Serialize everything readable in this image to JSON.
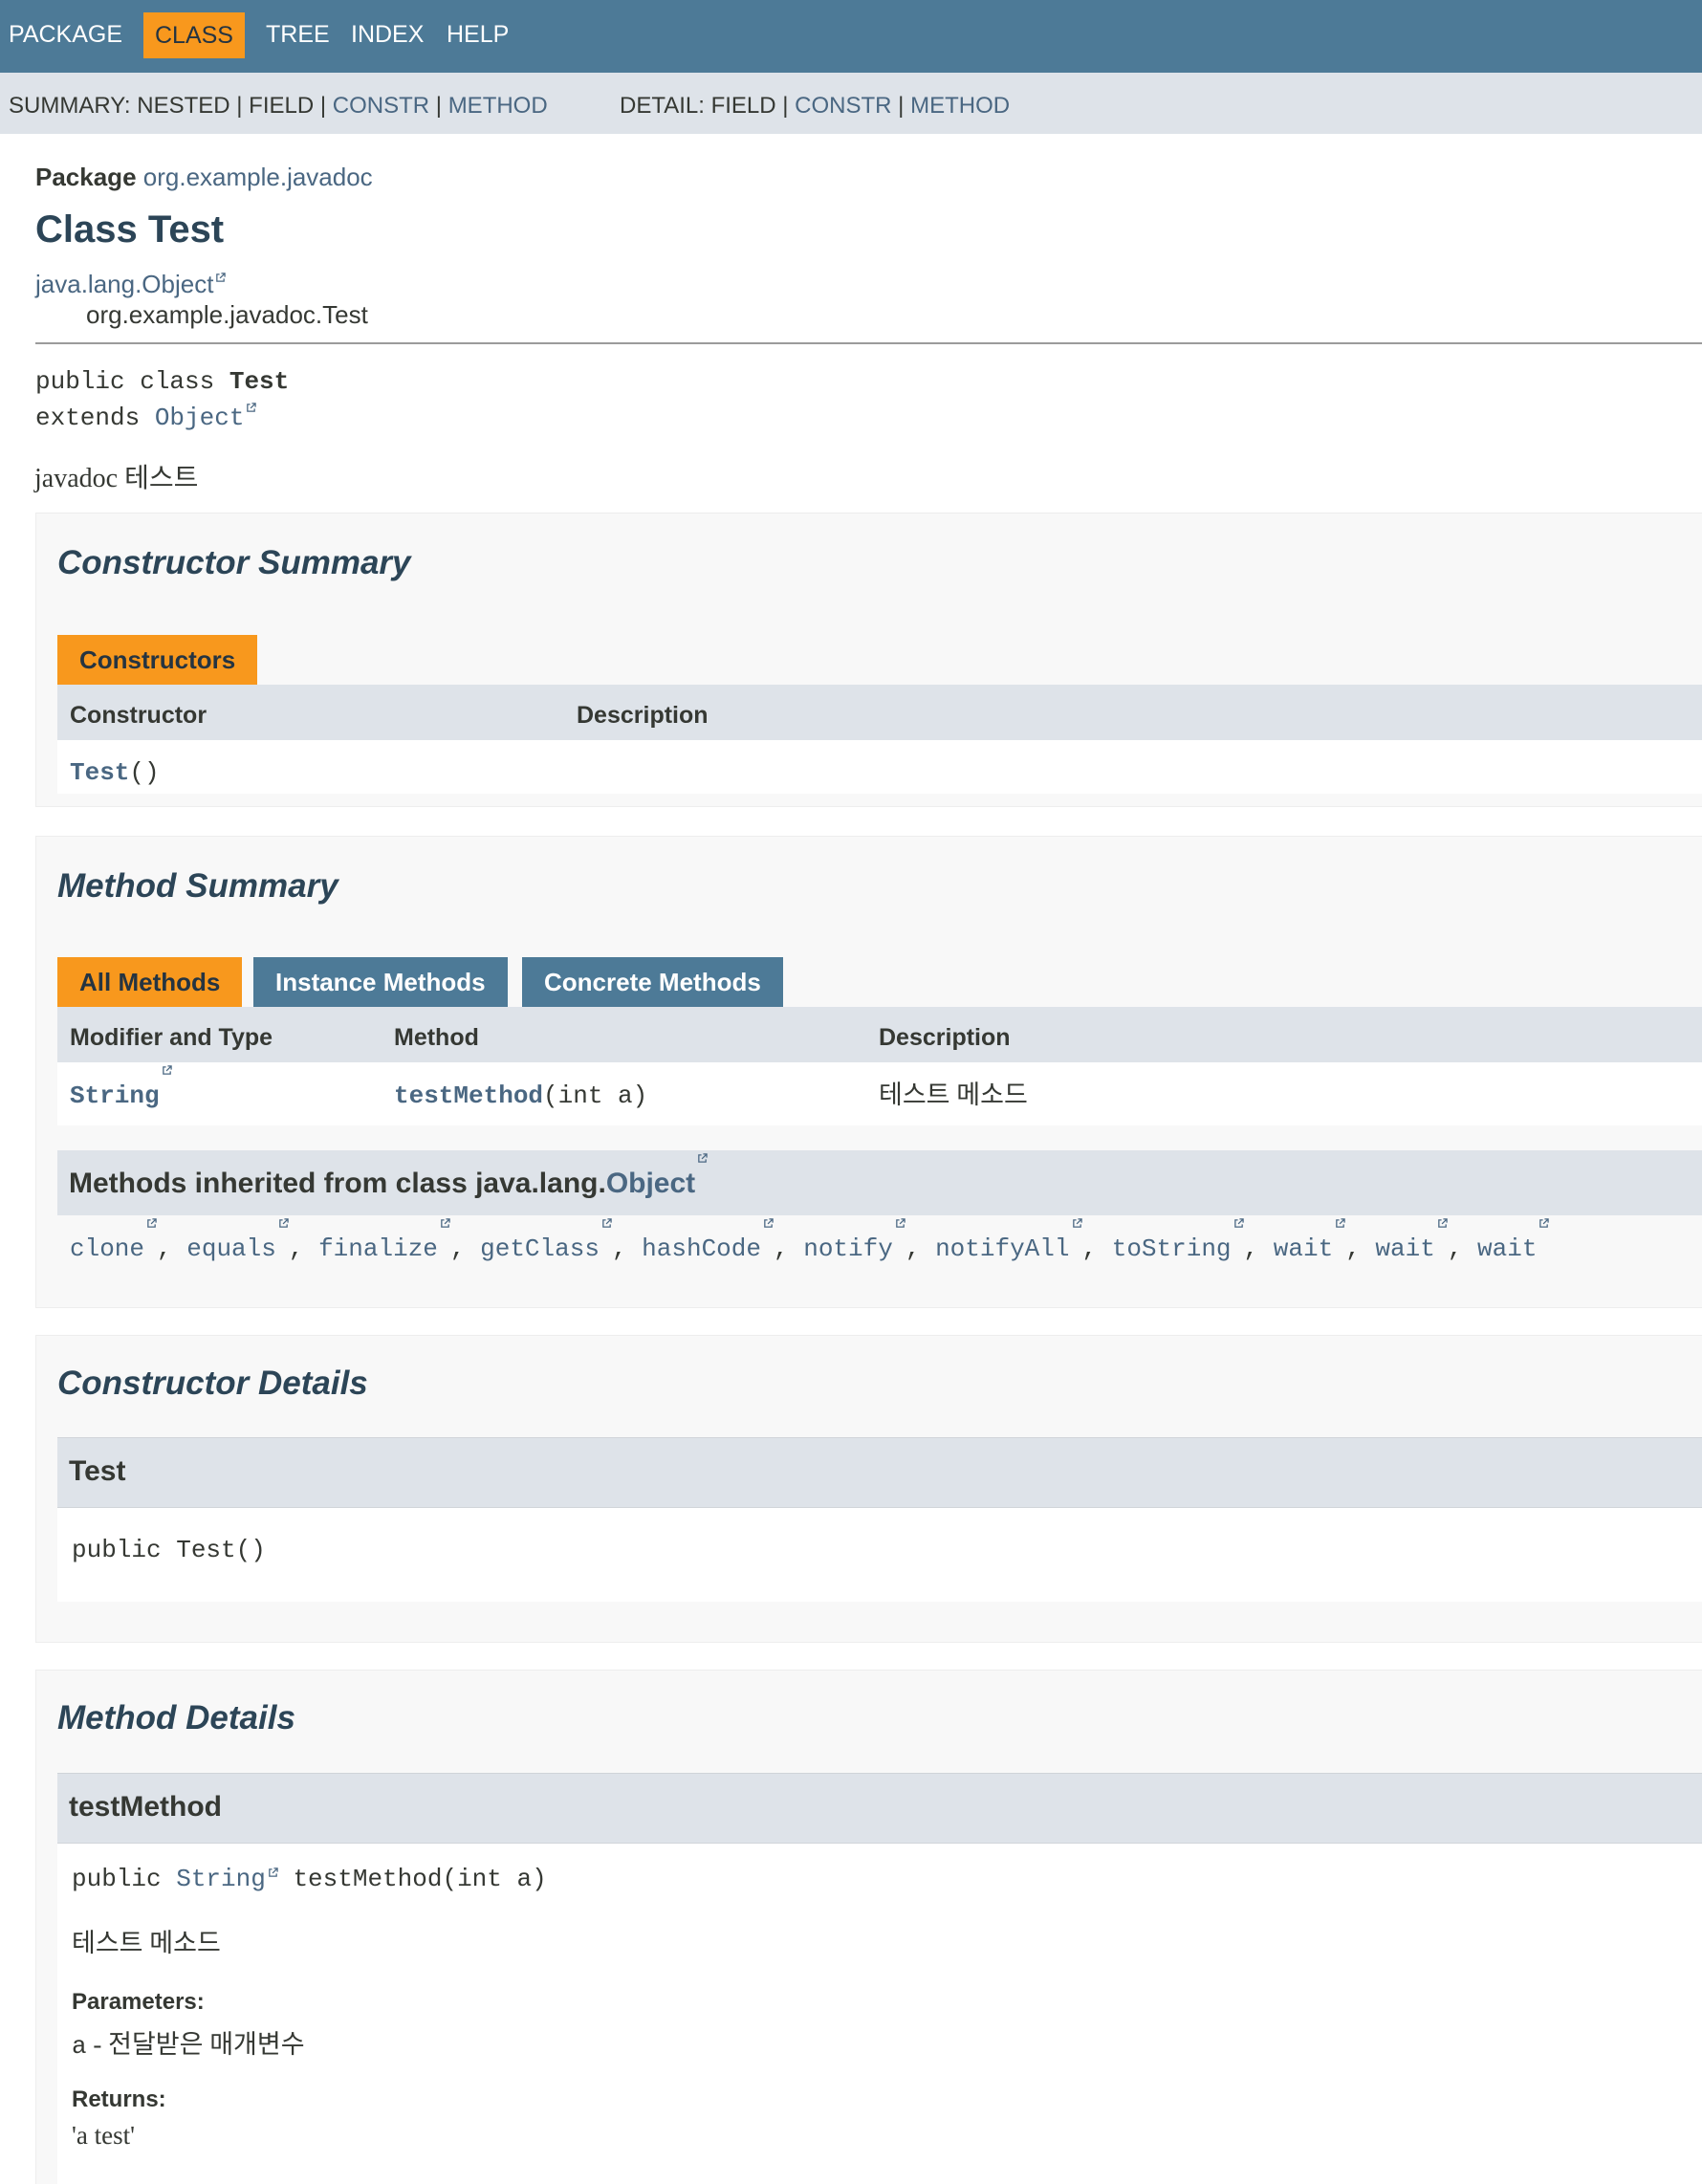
{
  "top_nav": {
    "items": [
      {
        "label": "PACKAGE",
        "active": false
      },
      {
        "label": "CLASS",
        "active": true
      },
      {
        "label": "TREE",
        "active": false
      },
      {
        "label": "INDEX",
        "active": false
      },
      {
        "label": "HELP",
        "active": false
      }
    ]
  },
  "sub_nav": {
    "summary_label": "SUMMARY: NESTED | FIELD | ",
    "summary_constr": "CONSTR",
    "sep1": " | ",
    "summary_method": "METHOD",
    "detail_label": "DETAIL: FIELD | ",
    "detail_constr": "CONSTR",
    "sep2": " | ",
    "detail_method": "METHOD"
  },
  "header": {
    "package_label": "Package",
    "package_name": "org.example.javadoc",
    "class_title": "Class Test",
    "inheritance_root": "java.lang.Object",
    "inheritance_child": "org.example.javadoc.Test"
  },
  "signature": {
    "line1_prefix": "public class ",
    "line1_name": "Test",
    "line2_prefix": "extends ",
    "line2_link": "Object"
  },
  "class_description": "javadoc 테스트",
  "constructor_summary": {
    "title": "Constructor Summary",
    "tab": "Constructors",
    "col_constructor": "Constructor",
    "col_description": "Description",
    "rows": [
      {
        "name": "Test",
        "params": "()"
      }
    ]
  },
  "method_summary": {
    "title": "Method Summary",
    "tabs": [
      {
        "label": "All Methods",
        "active": true
      },
      {
        "label": "Instance Methods",
        "active": false
      },
      {
        "label": "Concrete Methods",
        "active": false
      }
    ],
    "col_modifier": "Modifier and Type",
    "col_method": "Method",
    "col_description": "Description",
    "rows": [
      {
        "type": "String",
        "name": "testMethod",
        "params": "(int a)",
        "description": "테스트 메소드"
      }
    ],
    "inherited_prefix": "Methods inherited from class java.lang.",
    "inherited_class": "Object",
    "inherited_methods": [
      "clone",
      "equals",
      "finalize",
      "getClass",
      "hashCode",
      "notify",
      "notifyAll",
      "toString",
      "wait",
      "wait",
      "wait"
    ]
  },
  "constructor_details": {
    "title": "Constructor Details",
    "member_name": "Test",
    "signature": "public Test()"
  },
  "method_details": {
    "title": "Method Details",
    "member_name": "testMethod",
    "sig_prefix": "public ",
    "sig_type": "String",
    "sig_rest": " testMethod(int a)",
    "description": "테스트 메소드",
    "params_label": "Parameters:",
    "param_name": "a",
    "param_desc": " - 전달받은 매개변수",
    "returns_label": "Returns:",
    "returns_value": "'a test'"
  },
  "colors": {
    "nav_bg": "#4d7a97",
    "active_tab": "#f8981d",
    "subnav_bg": "#dee3e9",
    "link": "#4a6782",
    "title": "#2c4557"
  },
  "icons": {
    "external_link": "external-link-icon"
  }
}
